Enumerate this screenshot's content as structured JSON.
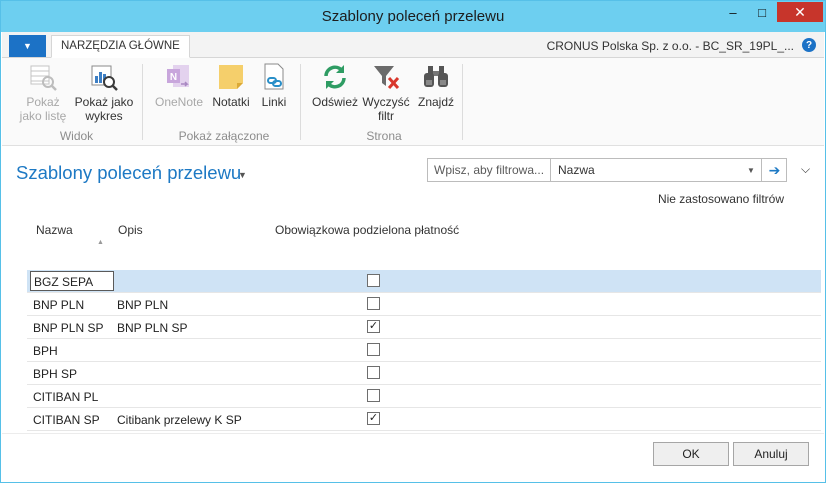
{
  "window": {
    "title": "Szablony poleceń przelewu",
    "controls": {
      "minimize": "–",
      "maximize": "□",
      "close": "✕"
    }
  },
  "ribbon": {
    "app_menu_icon": "caret-down-icon",
    "tab_home": "NARZĘDZIA GŁÓWNE",
    "company": "CRONUS Polska Sp. z o.o. - BC_SR_19PL_...",
    "help": "?",
    "groups": [
      {
        "label": "Widok",
        "buttons": [
          {
            "label_line1": "Pokaż",
            "label_line2": "jako listę",
            "icon": "list-view-icon",
            "enabled": false
          },
          {
            "label_line1": "Pokaż jako",
            "label_line2": "wykres",
            "icon": "chart-view-icon",
            "enabled": true
          }
        ]
      },
      {
        "label": "Pokaż załączone",
        "buttons": [
          {
            "label_line1": "OneNote",
            "label_line2": "",
            "icon": "onenote-icon",
            "enabled": false
          },
          {
            "label_line1": "Notatki",
            "label_line2": "",
            "icon": "notes-icon",
            "enabled": true
          },
          {
            "label_line1": "Linki",
            "label_line2": "",
            "icon": "links-icon",
            "enabled": true
          }
        ]
      },
      {
        "label": "Strona",
        "buttons": [
          {
            "label_line1": "Odśwież",
            "label_line2": "",
            "icon": "refresh-icon",
            "enabled": true
          },
          {
            "label_line1": "Wyczyść",
            "label_line2": "filtr",
            "icon": "clear-filter-icon",
            "enabled": true
          },
          {
            "label_line1": "Znajdź",
            "label_line2": "",
            "icon": "find-icon",
            "enabled": true
          }
        ]
      }
    ]
  },
  "page": {
    "title": "Szablony poleceń przelewu",
    "filter_placeholder": "Wpisz, aby filtrowa...",
    "filter_field": "Nazwa",
    "filter_status": "Nie zastosowano filtrów"
  },
  "grid": {
    "columns": [
      "Nazwa",
      "Opis",
      "Obowiązkowa podzielona płatność"
    ],
    "rows": [
      {
        "name": "BGZ SEPA",
        "desc": "",
        "split": false,
        "selected": true
      },
      {
        "name": "BNP PLN",
        "desc": "BNP PLN",
        "split": false,
        "selected": false
      },
      {
        "name": "BNP PLN SP",
        "desc": "BNP PLN SP",
        "split": true,
        "selected": false
      },
      {
        "name": "BPH",
        "desc": "",
        "split": false,
        "selected": false
      },
      {
        "name": "BPH SP",
        "desc": "",
        "split": false,
        "selected": false
      },
      {
        "name": "CITIBAN PL",
        "desc": "",
        "split": false,
        "selected": false
      },
      {
        "name": "CITIBAN SP",
        "desc": "Citibank przelewy K SP",
        "split": true,
        "selected": false
      }
    ]
  },
  "buttons": {
    "ok": "OK",
    "cancel": "Anuluj"
  }
}
